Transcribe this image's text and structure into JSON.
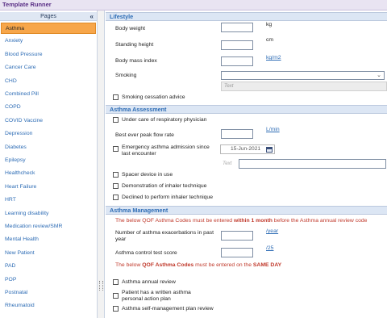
{
  "app_title": "Template Runner",
  "sidebar": {
    "header": "Pages",
    "collapse_glyph": "«",
    "items": [
      "Asthma",
      "Anxiety",
      "Blood Pressure",
      "Cancer Care",
      "CHD",
      "Combined Pill",
      "COPD",
      "COVID Vaccine",
      "Depression",
      "Diabetes",
      "Epilepsy",
      "Healthcheck",
      "Heart Failure",
      "HRT",
      "Learning disability",
      "Medication review/SMR",
      "Mental Health",
      "New Patient",
      "PAD",
      "POP",
      "Postnatal",
      "Rheumatoid"
    ],
    "active_item": "Asthma"
  },
  "lifestyle": {
    "header": "Lifestyle",
    "body_weight": {
      "label": "Body weight",
      "unit": "kg",
      "value": ""
    },
    "standing_height": {
      "label": "Standing height",
      "unit": "cm",
      "value": ""
    },
    "bmi": {
      "label": "Body mass index",
      "unit": "kg/m2",
      "value": ""
    },
    "smoking": {
      "label": "Smoking",
      "value": "",
      "text_placeholder": "Text"
    },
    "cessation": {
      "label": "Smoking cessation advice",
      "checked": false
    }
  },
  "assessment": {
    "header": "Asthma Assessment",
    "under_care": {
      "label": "Under care of respiratory physician",
      "checked": false
    },
    "peak_flow": {
      "label": "Best ever peak flow rate",
      "unit": "L/min",
      "value": ""
    },
    "emergency": {
      "label": "Emergency asthma admission since last encounter",
      "date": "15-Jun-2021",
      "checked": false,
      "text_placeholder": "Text"
    },
    "spacer": {
      "label": "Spacer device in use",
      "checked": false
    },
    "demo_inhaler": {
      "label": "Demonstration of inhaler technique",
      "checked": false
    },
    "declined_inhaler": {
      "label": "Declined to perform inhaler technique",
      "checked": false
    }
  },
  "management": {
    "header": "Asthma Management",
    "notice1_a": "The below QOF Asthma Codes must be entered ",
    "notice1_b": "within 1 month",
    "notice1_c": " before the Asthma annual review code",
    "exacerbations": {
      "label": "Number of asthma exacerbations in past year",
      "unit": "/year",
      "value": ""
    },
    "control_test": {
      "label": "Asthma control test score",
      "unit": "/25",
      "value": ""
    },
    "notice2_a": "The below ",
    "notice2_b": "QOF Asthma Codes",
    "notice2_c": " must be entered on the ",
    "notice2_d": "SAME DAY",
    "annual_review": {
      "label": "Asthma annual review",
      "checked": false
    },
    "written_plan": {
      "label": "Patient has a written asthma personal action plan",
      "checked": false
    },
    "self_mgmt": {
      "label": "Asthma self-management plan review",
      "checked": false
    }
  },
  "colors": {
    "accent": "#2d6cb5",
    "active_item": "#f7a64a",
    "notice": "#c0392b",
    "title": "#5a2f86"
  },
  "icons": {
    "dropdown": "chevron-down-icon",
    "calendar": "calendar-icon",
    "collapse": "double-chevron-left-icon"
  }
}
